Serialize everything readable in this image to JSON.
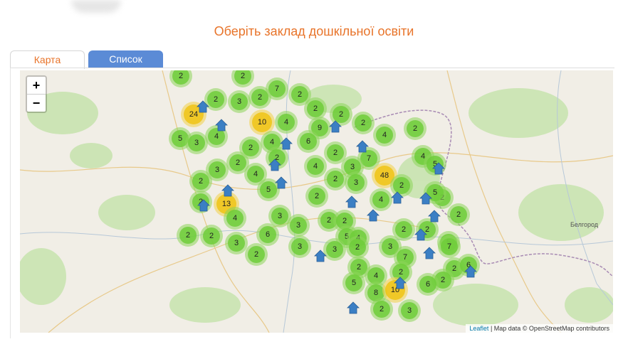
{
  "title": "Оберіть заклад дошкільної освіти",
  "tabs": [
    {
      "label": "Карта",
      "active": true
    },
    {
      "label": "Список",
      "active": false
    }
  ],
  "zoom": {
    "in_label": "+",
    "out_label": "−"
  },
  "attribution": {
    "link": "Leaflet",
    "text": " | Map data © OpenStreetMap contributors"
  },
  "place_labels": [
    "Белгород"
  ],
  "colors": {
    "title": "#e8742a",
    "tab_inactive": "#5b8bd6",
    "cluster_small": "#6ecc39",
    "cluster_medium": "#f0c20c",
    "marker": "#3b7fc4"
  },
  "clusters": [
    "2",
    "2",
    "7",
    "2",
    "2",
    "3",
    "2",
    "24",
    "2",
    "10",
    "4",
    "9",
    "2",
    "2",
    "2",
    "5",
    "3",
    "4",
    "2",
    "4",
    "6",
    "2",
    "4",
    "7",
    "2",
    "2",
    "3",
    "4",
    "3",
    "4",
    "2",
    "48",
    "4",
    "5",
    "2",
    "3",
    "5",
    "2",
    "2",
    "2",
    "13",
    "4",
    "2",
    "5",
    "3",
    "2",
    "2",
    "2",
    "3",
    "2",
    "5",
    "2",
    "4",
    "3",
    "3",
    "6",
    "2",
    "2",
    "4",
    "5",
    "2",
    "3",
    "2",
    "3",
    "7",
    "7",
    "2",
    "2",
    "6",
    "2",
    "5",
    "4",
    "2",
    "6",
    "8",
    "10",
    "2",
    "3"
  ],
  "markers": [
    "home-marker",
    "home-marker",
    "home-marker",
    "home-marker",
    "home-marker",
    "home-marker",
    "home-marker",
    "home-marker",
    "home-marker",
    "home-marker",
    "home-marker",
    "home-marker",
    "home-marker",
    "home-marker",
    "home-marker",
    "home-marker",
    "home-marker",
    "home-marker",
    "home-marker",
    "home-marker",
    "home-marker"
  ]
}
